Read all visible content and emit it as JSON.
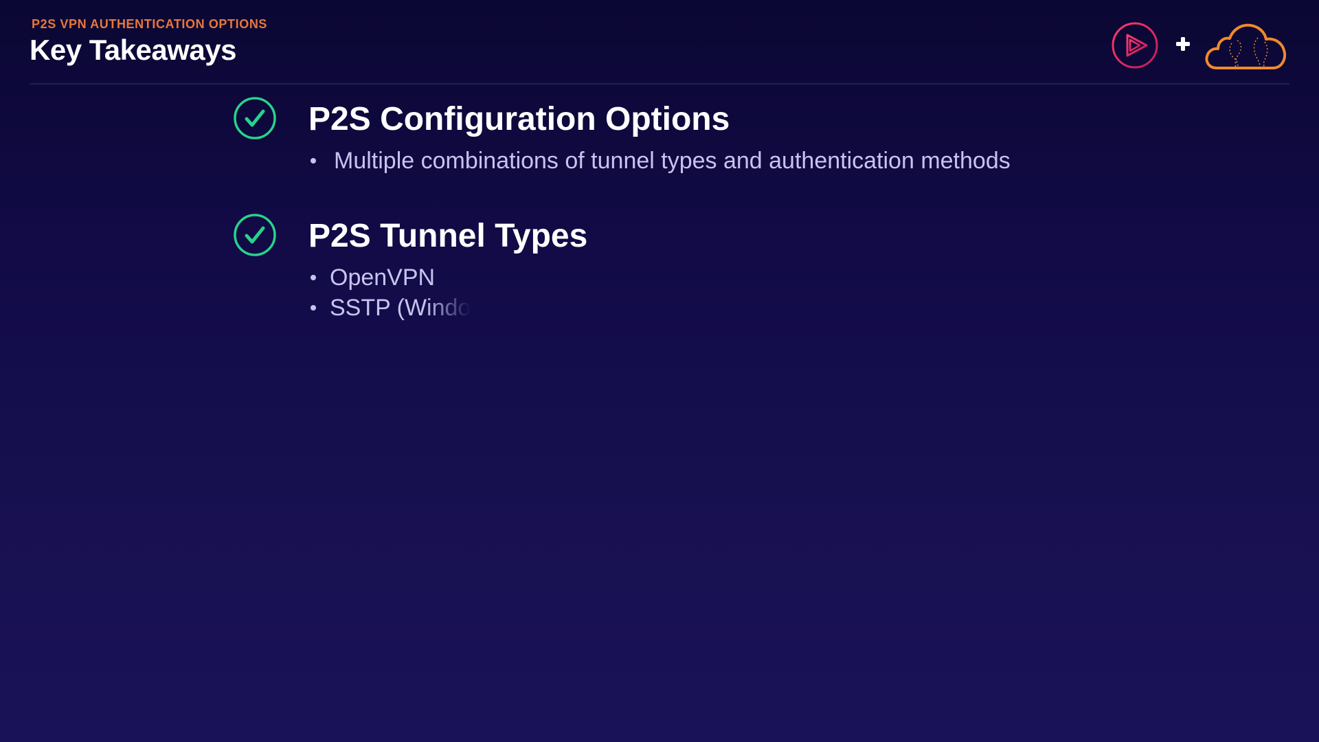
{
  "header": {
    "eyebrow": "P2S VPN AUTHENTICATION OPTIONS",
    "title": "Key Takeaways",
    "plus": "+"
  },
  "brand": {
    "left_logo_icon": "play-circle-icon",
    "right_logo_icon": "cloud-icon"
  },
  "colors": {
    "eyebrow": "#e8783a",
    "check": "#27d38a",
    "play_logo": "#e0265a",
    "cloud_logo": "#f08a2c"
  },
  "takeaways": [
    {
      "title": "P2S Configuration Options",
      "bullets": [
        "Multiple combinations of tunnel types and authentication methods"
      ]
    },
    {
      "title": "P2S Tunnel Types",
      "bullets": [
        "OpenVPN",
        "SSTP (Windo"
      ]
    }
  ]
}
